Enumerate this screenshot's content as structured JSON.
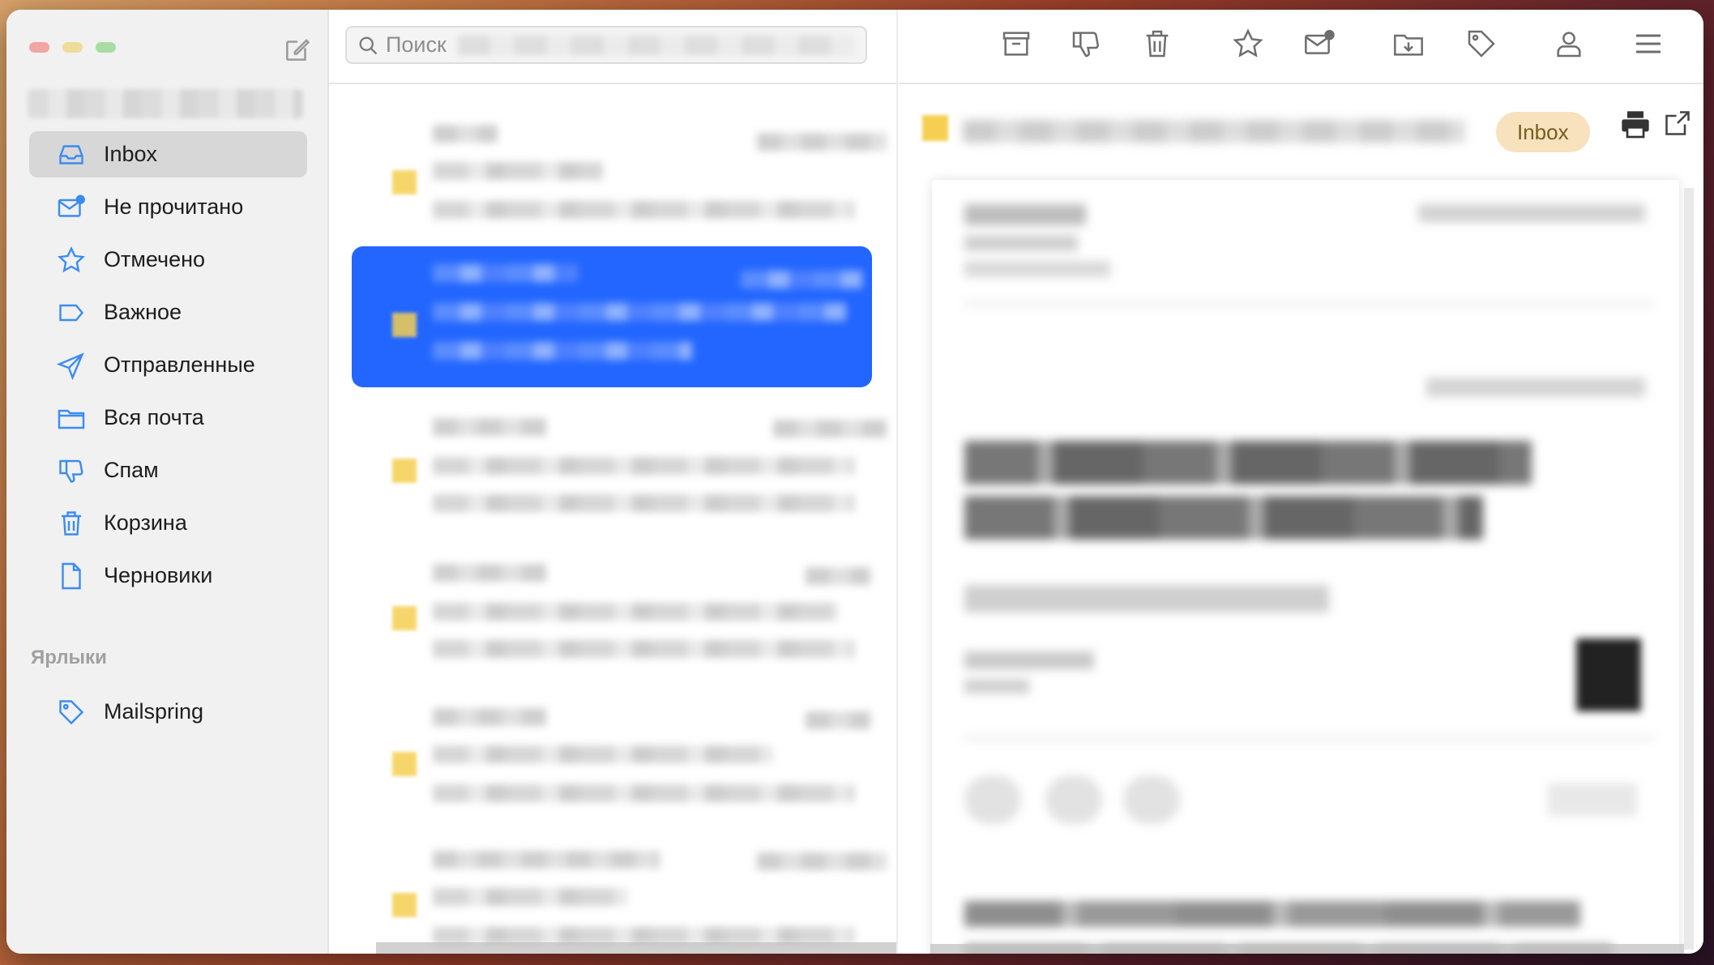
{
  "window": {
    "traffic_colors": [
      "#f2a5a5",
      "#f0dc9a",
      "#a8dca5"
    ]
  },
  "search": {
    "placeholder": "Поиск"
  },
  "sidebar": {
    "items": [
      {
        "label": "Inbox",
        "icon": "inbox-icon",
        "active": true
      },
      {
        "label": "Не прочитано",
        "icon": "unread-mail-icon"
      },
      {
        "label": "Отмечено",
        "icon": "star-icon"
      },
      {
        "label": "Важное",
        "icon": "important-label-icon"
      },
      {
        "label": "Отправленные",
        "icon": "sent-plane-icon"
      },
      {
        "label": "Вся почта",
        "icon": "folder-icon"
      },
      {
        "label": "Спам",
        "icon": "thumbs-down-icon"
      },
      {
        "label": "Корзина",
        "icon": "trash-icon"
      },
      {
        "label": "Черновики",
        "icon": "draft-file-icon"
      }
    ],
    "section_title": "Ярлыки",
    "labels": [
      {
        "label": "Mailspring",
        "icon": "tag-icon"
      }
    ]
  },
  "toolbar": {
    "icons": [
      "archive-icon",
      "spam-icon",
      "trash-icon",
      "star-icon",
      "unread-mail-icon",
      "move-folder-icon",
      "tag-icon",
      "person-icon",
      "menu-icon"
    ]
  },
  "reader": {
    "badge": "Inbox"
  },
  "colors": {
    "accent": "#2266ff",
    "icon_blue": "#3b8cf0",
    "badge_bg": "#f7e2bd",
    "star": "#f5cf52"
  }
}
